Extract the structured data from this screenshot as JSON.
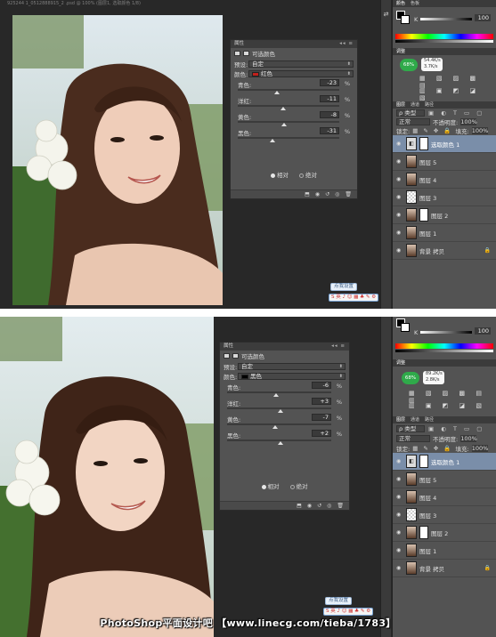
{
  "top": {
    "doc_title": "925244 1_0512888915_2 .psd @ 100% (图层1, 选取颜色 1/8)",
    "panel": {
      "title": "属性",
      "adjustment_label": "可选颜色",
      "preset_label": "预设:",
      "preset_value": "自定",
      "colors_label": "颜色:",
      "colors_value": "红色",
      "colors_swatch": "#c1201b",
      "sliders": [
        {
          "name": "青色:",
          "value": "-23",
          "level": -23
        },
        {
          "name": "洋红:",
          "value": "-11",
          "level": -11
        },
        {
          "name": "黄色:",
          "value": "-8",
          "level": -8
        },
        {
          "name": "黑色:",
          "value": "-31",
          "level": -31
        }
      ],
      "pct": "%",
      "relative_label": "相对",
      "absolute_label": "绝对"
    },
    "dock": {
      "color_tabs": [
        "颜色",
        "色板"
      ],
      "k_value": "100",
      "adjust_tab": "调整",
      "badge_pct": "68%",
      "net_up": "54.4K/s",
      "net_down": "3.7K/s",
      "layer_tabs": [
        "图层",
        "通道",
        "路径"
      ],
      "kind_label": "ρ 类型",
      "blend_mode": "正常",
      "opacity_label": "不透明度:",
      "opacity_value": "100%",
      "lock_label": "锁定:",
      "fill_label": "填充:",
      "fill_value": "100%",
      "layers": [
        {
          "name": "选取颜色 1",
          "thumb": "adj",
          "selected": true
        },
        {
          "name": "图层 5",
          "thumb": "img",
          "selected": false
        },
        {
          "name": "图层 4",
          "thumb": "img",
          "selected": false
        },
        {
          "name": "图层 3",
          "thumb": "check",
          "selected": false
        },
        {
          "name": "图层 2",
          "thumb": "img-mask",
          "selected": false
        },
        {
          "name": "图层 1",
          "thumb": "img",
          "selected": false
        },
        {
          "name": "背景 拷贝",
          "thumb": "img",
          "selected": false
        }
      ]
    },
    "ime_tip": "点我设置",
    "ime_bar": "S 英 ♪ ☺ ▦ ♣ ✎ ⚙"
  },
  "bottom": {
    "panel": {
      "title": "属性",
      "adjustment_label": "可选颜色",
      "preset_label": "预设:",
      "preset_value": "自定",
      "colors_label": "颜色:",
      "colors_value": "黑色",
      "colors_swatch": "#000000",
      "sliders": [
        {
          "name": "青色:",
          "value": "-6",
          "level": -6
        },
        {
          "name": "洋红:",
          "value": "+3",
          "level": 3
        },
        {
          "name": "黄色:",
          "value": "-7",
          "level": -7
        },
        {
          "name": "黑色:",
          "value": "+2",
          "level": 2
        }
      ],
      "pct": "%",
      "relative_label": "相对",
      "absolute_label": "绝对"
    },
    "dock": {
      "k_value": "100",
      "adjust_tab": "调整",
      "badge_pct": "68%",
      "net_up": "89.2K/s",
      "net_down": "2.8K/s",
      "layer_tabs": [
        "图层",
        "通道",
        "路径"
      ],
      "kind_label": "ρ 类型",
      "blend_mode": "正常",
      "opacity_label": "不透明度:",
      "opacity_value": "100%",
      "lock_label": "锁定:",
      "fill_label": "填充:",
      "fill_value": "100%",
      "layers": [
        {
          "name": "选取颜色 1",
          "thumb": "adj",
          "selected": true
        },
        {
          "name": "图层 5",
          "thumb": "img",
          "selected": false
        },
        {
          "name": "图层 4",
          "thumb": "img",
          "selected": false
        },
        {
          "name": "图层 3",
          "thumb": "check",
          "selected": false
        },
        {
          "name": "图层 2",
          "thumb": "img-mask",
          "selected": false
        },
        {
          "name": "图层 1",
          "thumb": "img",
          "selected": false
        },
        {
          "name": "背景 拷贝",
          "thumb": "img",
          "selected": false
        }
      ]
    },
    "ime_tip": "点我设置",
    "ime_bar": "S 英 ♪ ☺ ▦ ♣ ✎ ⚙"
  },
  "watermark": "PhotoShop平面设计吧 【www.linecg.com/tieba/1783】"
}
